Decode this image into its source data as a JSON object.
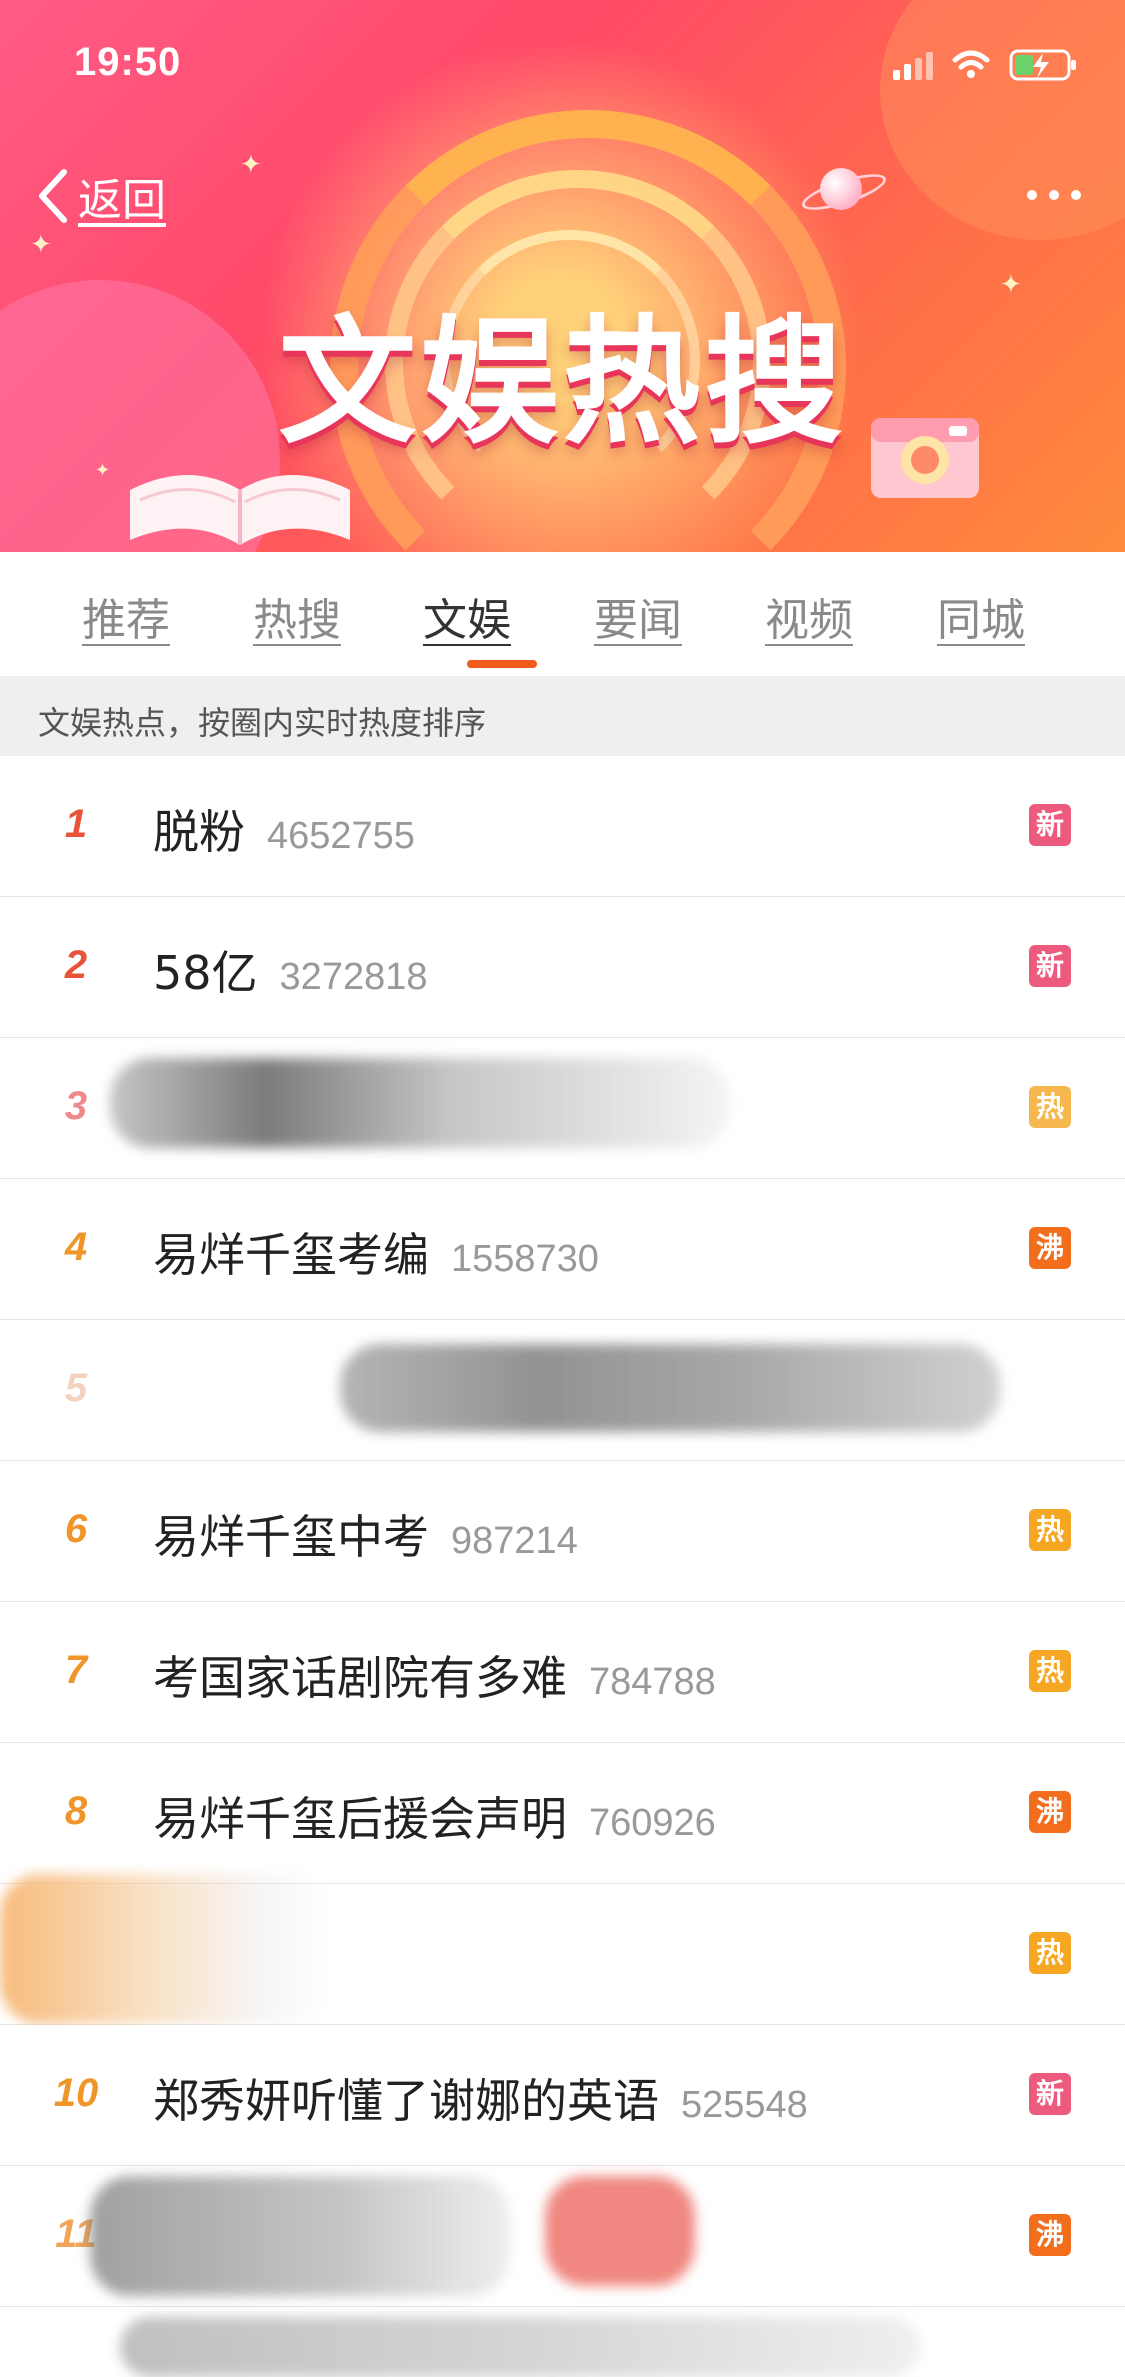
{
  "status_bar": {
    "time": "19:50"
  },
  "nav": {
    "back_label": "返回"
  },
  "banner": {
    "title": "文娱热搜"
  },
  "tabs": [
    {
      "label": "推荐"
    },
    {
      "label": "热搜"
    },
    {
      "label": "文娱",
      "active": true
    },
    {
      "label": "要闻"
    },
    {
      "label": "视频"
    },
    {
      "label": "同城"
    }
  ],
  "info_bar": {
    "text": "文娱热点，按圈内实时热度排序"
  },
  "colors": {
    "rank_red": "#e8533a",
    "rank_pink": "#f08a8a",
    "rank_orange": "#f0952a",
    "badge_new": "#ec5a7e",
    "badge_hot": "#f5a623",
    "badge_boil": "#f26e1d",
    "tab_indicator": "#f05a1a"
  },
  "list": [
    {
      "rank": "1",
      "title": "脱粉",
      "count": "4652755",
      "badge": "新",
      "badge_type": "new",
      "rank_color": "red"
    },
    {
      "rank": "2",
      "title": "58亿",
      "count": "3272818",
      "badge": "新",
      "badge_type": "new",
      "rank_color": "red"
    },
    {
      "rank": "3",
      "title": "",
      "count": "",
      "badge": "热",
      "badge_type": "hot",
      "rank_color": "pink",
      "obscured": true
    },
    {
      "rank": "4",
      "title": "易烊千玺考编",
      "count": "1558730",
      "badge": "沸",
      "badge_type": "boil",
      "rank_color": "orange"
    },
    {
      "rank": "5",
      "title": "",
      "count": "",
      "badge": "",
      "badge_type": "none",
      "rank_color": "faint",
      "obscured": true
    },
    {
      "rank": "6",
      "title": "易烊千玺中考",
      "count": "987214",
      "badge": "热",
      "badge_type": "hot",
      "rank_color": "orange"
    },
    {
      "rank": "7",
      "title": "考国家话剧院有多难",
      "count": "784788",
      "badge": "热",
      "badge_type": "hot",
      "rank_color": "orange"
    },
    {
      "rank": "8",
      "title": "易烊千玺后援会声明",
      "count": "760926",
      "badge": "沸",
      "badge_type": "boil",
      "rank_color": "orange"
    },
    {
      "rank": "",
      "title": "",
      "count": "",
      "badge": "热",
      "badge_type": "hot",
      "rank_color": "orange",
      "obscured": true
    },
    {
      "rank": "10",
      "title": "郑秀妍听懂了谢娜的英语",
      "count": "525548",
      "badge": "新",
      "badge_type": "new",
      "rank_color": "orange"
    },
    {
      "rank": "11",
      "title": "",
      "count": "",
      "badge": "沸",
      "badge_type": "boil",
      "rank_color": "orange",
      "obscured": true
    }
  ]
}
